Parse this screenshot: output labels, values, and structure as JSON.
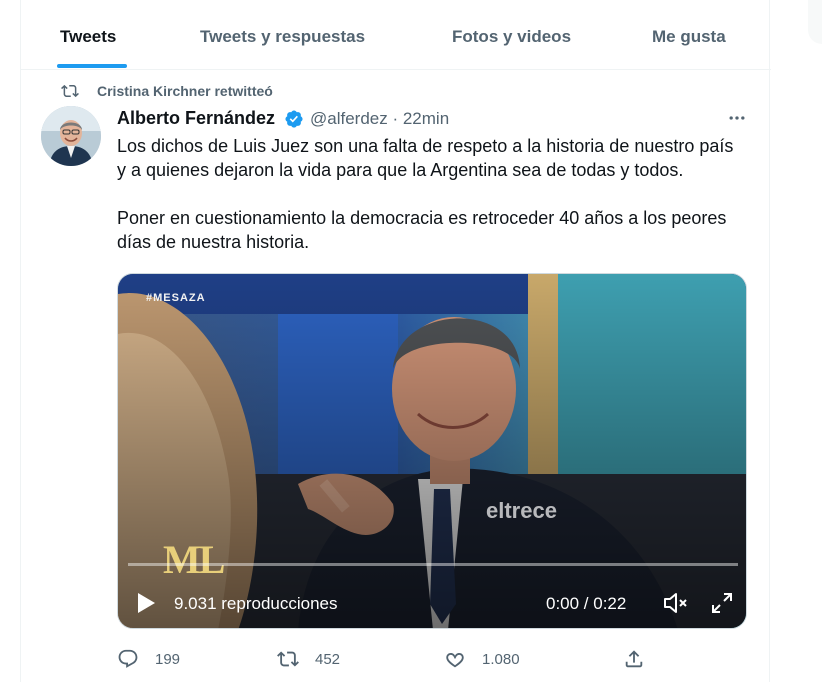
{
  "tabs": [
    {
      "label": "Tweets",
      "active": true
    },
    {
      "label": "Tweets y respuestas",
      "active": false
    },
    {
      "label": "Fotos y videos",
      "active": false
    },
    {
      "label": "Me gusta",
      "active": false
    }
  ],
  "tweet": {
    "retweeted_by": "Cristina Kirchner retwitteó",
    "author_name": "Alberto Fernández",
    "handle_time": "@alferdez · 22min",
    "paragraphs": [
      "Los dichos de Luis Juez son una falta de respeto a la historia de nuestro país y a quienes dejaron la vida para que la Argentina sea de todas y todos.",
      "Poner en cuestionamiento la democracia es retroceder 40 años a los peores días de nuestra historia."
    ],
    "video": {
      "hashtag": "#MESAZA",
      "logo": "ML",
      "watermark": "eltrece",
      "views": "9.031 reproducciones",
      "time": "0:00 / 0:22"
    },
    "stats": {
      "replies": "199",
      "retweets": "452",
      "likes": "1.080"
    }
  },
  "colors": {
    "accent": "#1d9bf0",
    "text": "#0f1419",
    "secondary": "#536471"
  },
  "icons": [
    "retweet-icon",
    "verified-icon",
    "more-icon",
    "play-icon",
    "mute-icon",
    "fullscreen-icon",
    "reply-icon",
    "like-icon",
    "share-icon"
  ]
}
